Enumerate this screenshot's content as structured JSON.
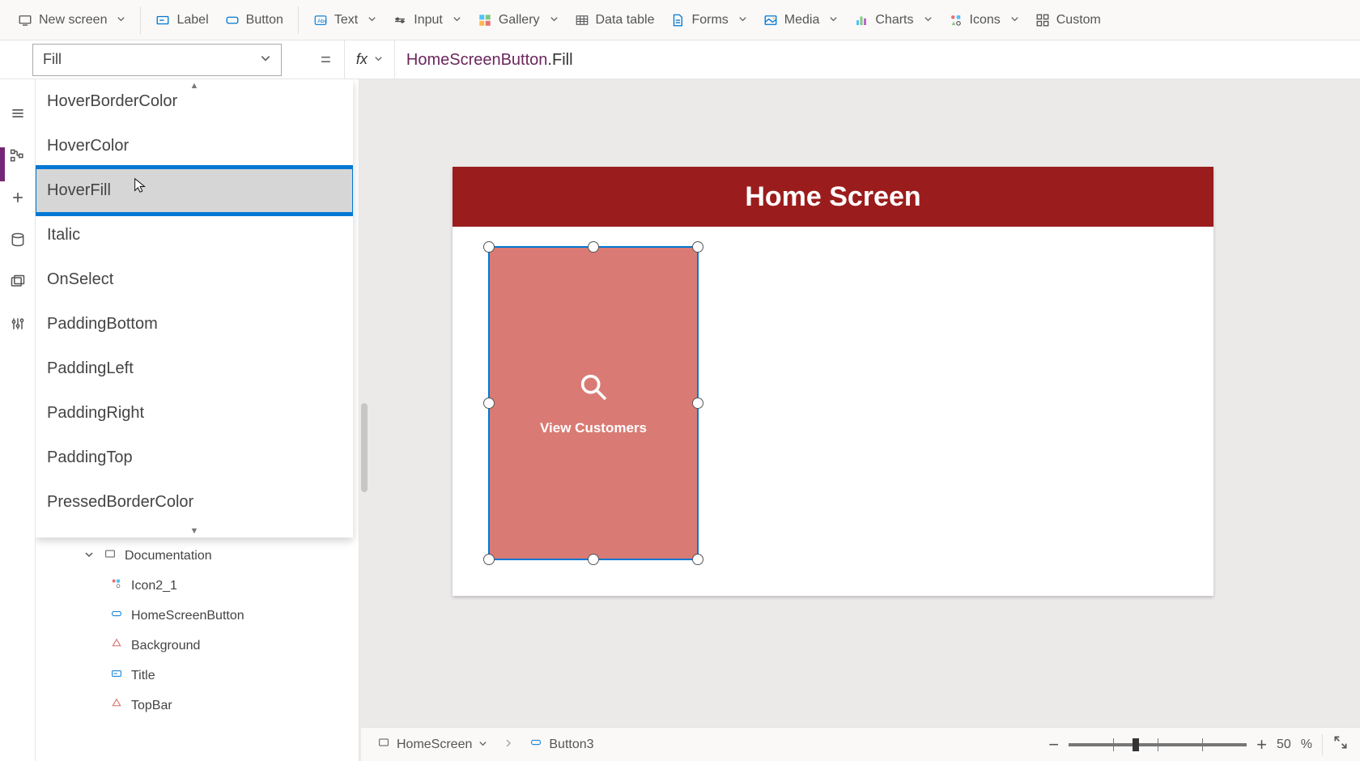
{
  "ribbon": {
    "new_screen": "New screen",
    "label": "Label",
    "button": "Button",
    "text": "Text",
    "input": "Input",
    "gallery": "Gallery",
    "data_table": "Data table",
    "forms": "Forms",
    "media": "Media",
    "charts": "Charts",
    "icons": "Icons",
    "custom": "Custom"
  },
  "property_selector": {
    "current": "Fill"
  },
  "formula": {
    "identifier": "HomeScreenButton",
    "member": ".Fill"
  },
  "dropdown": {
    "items": [
      "HoverBorderColor",
      "HoverColor",
      "HoverFill",
      "Italic",
      "OnSelect",
      "PaddingBottom",
      "PaddingLeft",
      "PaddingRight",
      "PaddingTop",
      "PressedBorderColor"
    ],
    "highlighted_index": 2
  },
  "tree": {
    "parent": "Documentation",
    "items": [
      "Icon2_1",
      "HomeScreenButton",
      "Background",
      "Title",
      "TopBar"
    ]
  },
  "canvas": {
    "header_title": "Home Screen",
    "card_label": "View Customers"
  },
  "status": {
    "crumb_screen": "HomeScreen",
    "crumb_control": "Button3",
    "zoom_value": "50",
    "zoom_unit": "%"
  }
}
